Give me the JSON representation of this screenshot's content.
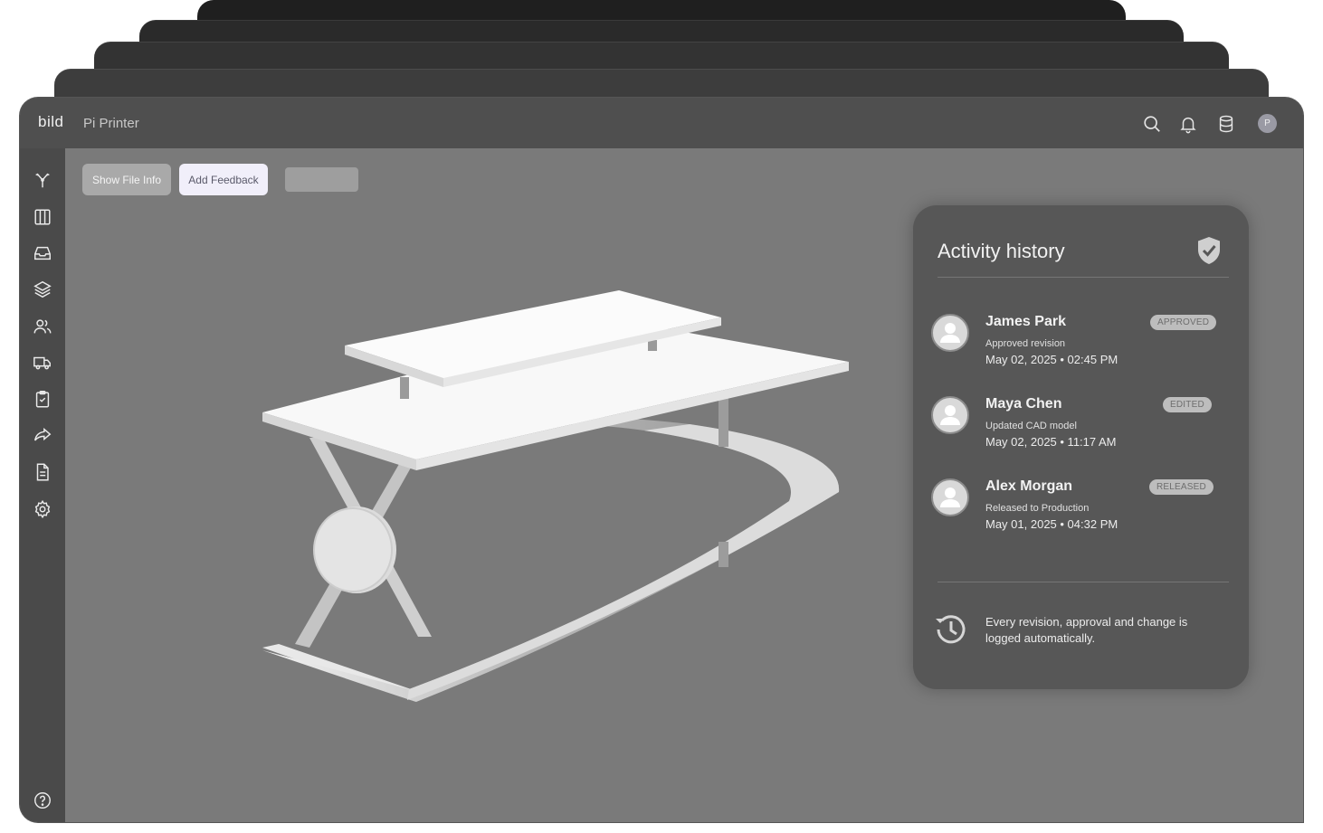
{
  "app": {
    "logo": "bild",
    "project_name": "Pi Printer",
    "user_initial": "P"
  },
  "toolbar": {
    "show_file_info": "Show File Info",
    "add_feedback": "Add Feedback"
  },
  "top_icons": [
    "search-icon",
    "bell-icon",
    "database-icon"
  ],
  "sidebar": {
    "icons": [
      "branch-icon",
      "columns-icon",
      "inbox-icon",
      "layers-icon",
      "users-icon",
      "truck-icon",
      "clipboard-check-icon",
      "share-icon",
      "document-icon",
      "settings-icon"
    ],
    "help_icon": "help-icon"
  },
  "activity": {
    "title": "Activity history",
    "entries": [
      {
        "name": "James Park",
        "action": "Approved revision",
        "time": "May 02, 2025 • 02:45 PM",
        "badge": "APPROVED"
      },
      {
        "name": "Maya Chen",
        "action": "Updated CAD model",
        "time": "May 02, 2025 • 11:17 AM",
        "badge": "EDITED"
      },
      {
        "name": "Alex Morgan",
        "action": "Released to Production",
        "time": "May 01, 2025 • 04:32 PM",
        "badge": "RELEASED"
      }
    ],
    "footer": "Every revision, approval and change is logged automatically."
  },
  "colors": {
    "canvas": "#7a7a7a",
    "topbar": "#4f4f4f",
    "sidebar": "#4a4a4a",
    "panel": "#575757",
    "feedback_button": "#f1effa"
  }
}
